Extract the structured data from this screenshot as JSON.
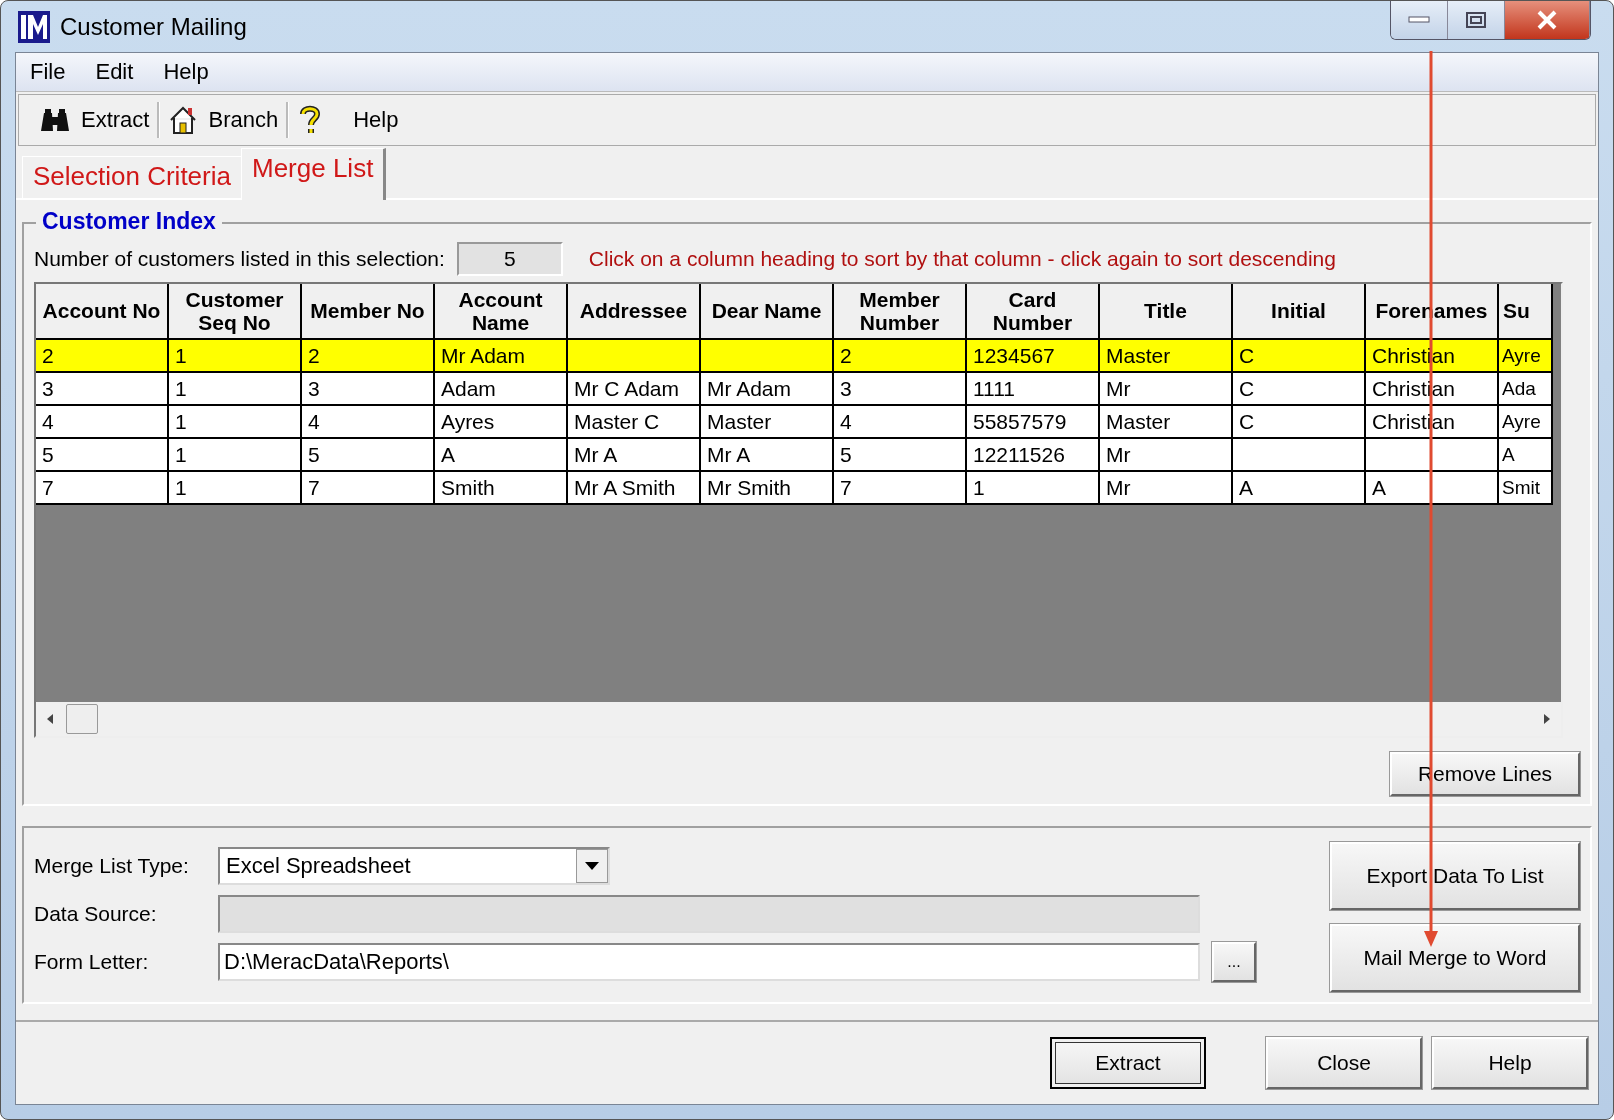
{
  "window": {
    "title": "Customer Mailing"
  },
  "menu": [
    "File",
    "Edit",
    "Help"
  ],
  "toolbar": [
    {
      "kind": "binoculars",
      "label": "Extract"
    },
    {
      "kind": "house",
      "label": "Branch"
    },
    {
      "kind": "question",
      "label": "Help"
    }
  ],
  "tabs": [
    {
      "label": "Selection Criteria",
      "selected": false
    },
    {
      "label": "Merge List",
      "selected": true
    }
  ],
  "customer_index": {
    "title": "Customer Index",
    "count_label": "Number of customers listed in this selection:",
    "count": "5",
    "hint": "Click on a column heading to sort by that column - click again to sort descending",
    "columns": [
      "Account No",
      "Customer Seq No",
      "Member No",
      "Account Name",
      "Addressee",
      "Dear Name",
      "Member Number",
      "Card Number",
      "Title",
      "Initial",
      "Forenames",
      "Su"
    ],
    "rows": [
      {
        "selected": true,
        "cells": [
          "2",
          "1",
          "2",
          "Mr Adam",
          "",
          "",
          "2",
          "1234567",
          "Master",
          "C",
          "Christian",
          "Ayre"
        ]
      },
      {
        "selected": false,
        "cells": [
          "3",
          "1",
          "3",
          "Adam",
          "Mr C Adam",
          "Mr Adam",
          "3",
          "1111",
          "Mr",
          "C",
          "Christian",
          "Ada"
        ]
      },
      {
        "selected": false,
        "cells": [
          "4",
          "1",
          "4",
          "Ayres",
          "Master C",
          "Master",
          "4",
          "55857579",
          "Master",
          "C",
          "Christian",
          "Ayre"
        ]
      },
      {
        "selected": false,
        "cells": [
          "5",
          "1",
          "5",
          "A",
          "Mr A",
          "Mr A",
          "5",
          "12211526",
          "Mr",
          "",
          "",
          "A"
        ]
      },
      {
        "selected": false,
        "cells": [
          "7",
          "1",
          "7",
          "Smith",
          "Mr A Smith",
          "Mr Smith",
          "7",
          "1",
          "Mr",
          "A",
          "A",
          "Smit"
        ]
      }
    ],
    "remove_button": "Remove Lines"
  },
  "merge": {
    "type_label": "Merge List Type:",
    "type_value": "Excel Spreadsheet",
    "source_label": "Data Source:",
    "letter_label": "Form Letter:",
    "letter_value": "D:\\MeracData\\Reports\\",
    "browse": "...",
    "export_button": "Export Data To List",
    "mail_button": "Mail Merge to Word"
  },
  "buttons": [
    {
      "label": "Extract",
      "selected": true
    },
    {
      "label": "Close",
      "selected": false
    },
    {
      "label": "Help",
      "selected": false
    }
  ]
}
